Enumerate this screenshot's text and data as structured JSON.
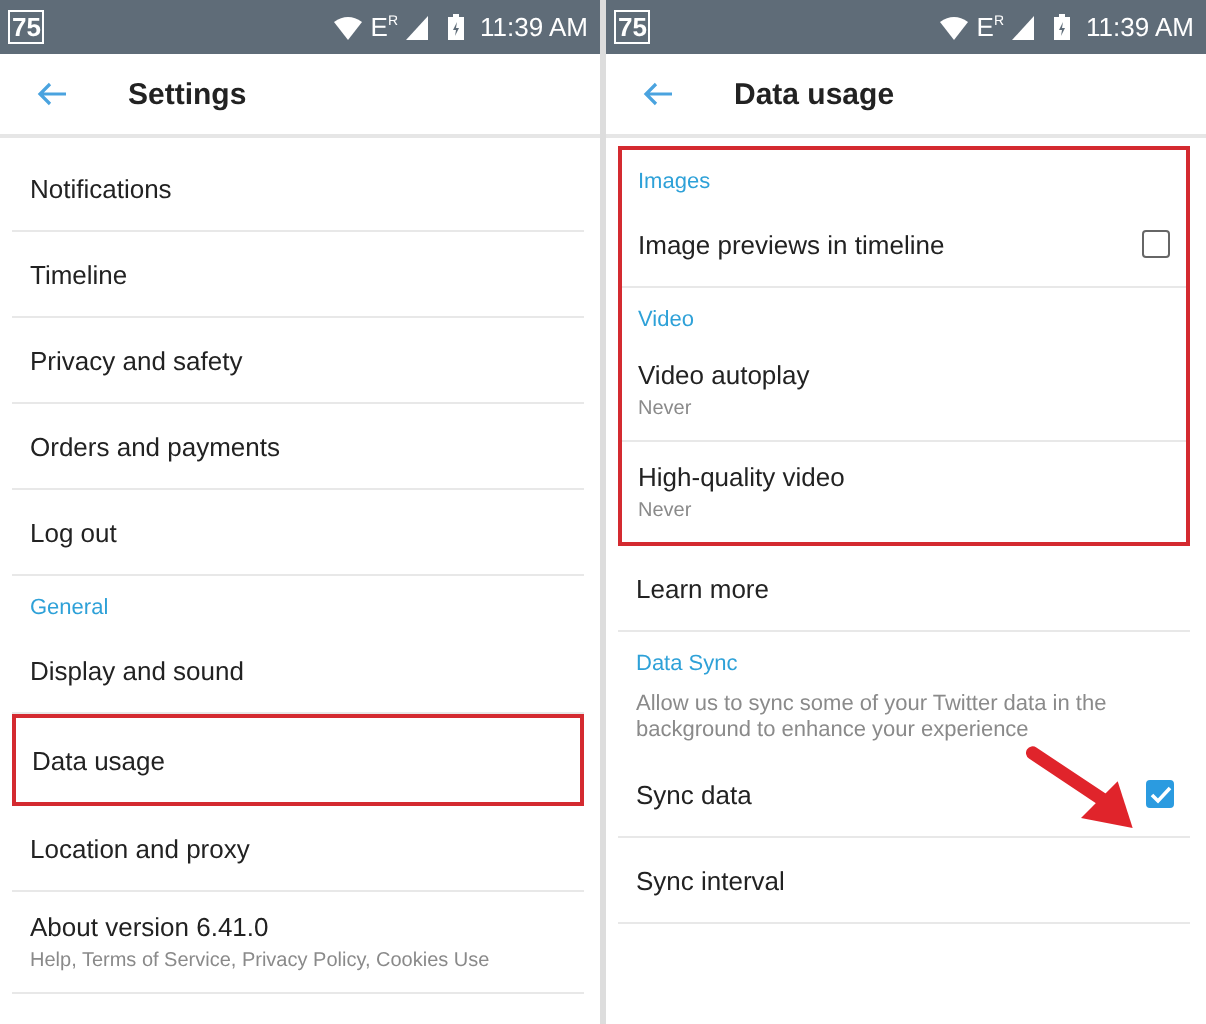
{
  "panels": [
    {
      "status_bar": {
        "badge": "75",
        "network": "E$^{R}$",
        "time": "11:39 AM"
      },
      "title": "Settings",
      "items": [
        {
          "kind": "item",
          "label": "Notifications"
        },
        {
          "kind": "item",
          "label": "Timeline"
        },
        {
          "kind": "item",
          "label": "Privacy and safety"
        },
        {
          "kind": "item",
          "label": "Orders and payments"
        },
        {
          "kind": "item",
          "label": "Log out"
        },
        {
          "kind": "section",
          "label": "General"
        },
        {
          "kind": "item",
          "label": "Display and sound"
        },
        {
          "kind": "frame",
          "items": [
            {
              "kind": "item",
              "label": "Data usage"
            }
          ]
        },
        {
          "kind": "item",
          "label": "Location and proxy"
        },
        {
          "kind": "item",
          "label": "About version 6.41.0",
          "subtitle": "Help, Terms of Service, Privacy Policy, Cookies Use"
        }
      ]
    },
    {
      "status_bar": {
        "badge": "75",
        "network": "E$^{R}$",
        "time": "11:39 AM"
      },
      "title": "Data usage",
      "items": [
        {
          "kind": "frame",
          "items": [
            {
              "kind": "section",
              "label": "Images"
            },
            {
              "kind": "check",
              "label": "Image previews in timeline",
              "checked": false
            },
            {
              "kind": "section",
              "label": "Video"
            },
            {
              "kind": "item",
              "label": "Video autoplay",
              "subtitle": "Never"
            },
            {
              "kind": "item",
              "label": "High-quality video",
              "subtitle": "Never"
            }
          ]
        },
        {
          "kind": "item",
          "label": "Learn more"
        },
        {
          "kind": "section",
          "label": "Data Sync"
        },
        {
          "kind": "note",
          "label": "Allow us to sync some of your Twitter data in the background to enhance your experience"
        },
        {
          "kind": "check",
          "label": "Sync data",
          "checked": true,
          "arrow": true
        },
        {
          "kind": "item",
          "label": "Sync interval"
        }
      ]
    }
  ]
}
